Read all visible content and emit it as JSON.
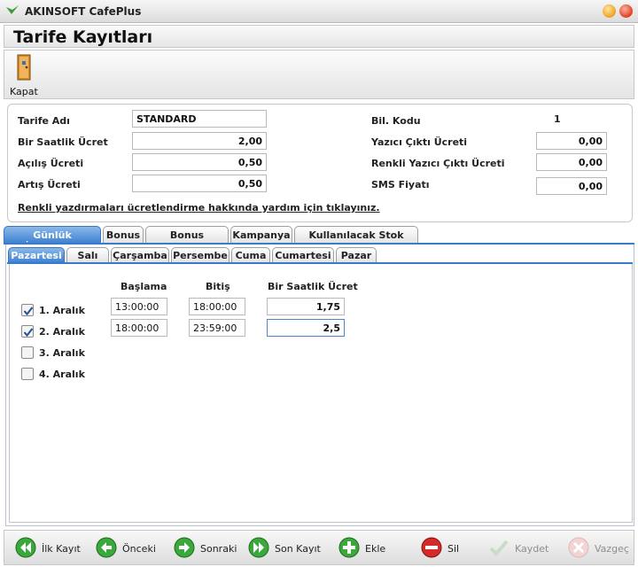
{
  "window": {
    "title": "AKINSOFT CafePlus"
  },
  "header": {
    "title": "Tarife Kayıtları"
  },
  "toolbar": {
    "close_label": "Kapat"
  },
  "form": {
    "tarife_adi": {
      "label": "Tarife Adı",
      "value": "STANDARD"
    },
    "bir_saatlik_ucret": {
      "label": "Bir Saatlik Ücret",
      "value": "2,00"
    },
    "acilis_ucreti": {
      "label": "Açılış Ücreti",
      "value": "0,50"
    },
    "artis_ucreti": {
      "label": "Artış Ücreti",
      "value": "0,50"
    },
    "bil_kodu": {
      "label": "Bil. Kodu",
      "value": "1"
    },
    "yazici_ucreti": {
      "label": "Yazıcı Çıktı Ücreti",
      "value": "0,00"
    },
    "renkli_yazici_ucreti": {
      "label": "Renkli Yazıcı Çıktı Ücreti",
      "value": "0,00"
    },
    "sms_fiyati": {
      "label": "SMS Fiyatı",
      "value": "0,00"
    },
    "help_link": "Renkli yazdırmaları ücretlendirme hakkında yardım için tıklayınız."
  },
  "tabs": [
    "Günlük İndirimler",
    "Bonus",
    "Bonus Fiyatları",
    "Kampanya",
    "Kullanılacak Stok Fiyatı"
  ],
  "active_tab": "Günlük İndirimler",
  "day_tabs": [
    "Pazartesi",
    "Salı",
    "Çarşamba",
    "Persembe",
    "Cuma",
    "Cumartesi",
    "Pazar"
  ],
  "active_day_tab": "Pazartesi",
  "intervals": {
    "headers": {
      "start": "Başlama",
      "end": "Bitiş",
      "hourly": "Bir Saatlik Ücret"
    },
    "rows": [
      {
        "label": "1. Aralık",
        "checked": true,
        "start": "13:00:00",
        "end": "18:00:00",
        "hourly": "1,75"
      },
      {
        "label": "2. Aralık",
        "checked": true,
        "start": "18:00:00",
        "end": "23:59:00",
        "hourly": "2,5"
      },
      {
        "label": "3. Aralık",
        "checked": false
      },
      {
        "label": "4. Aralık",
        "checked": false
      }
    ]
  },
  "nav": {
    "first": "İlk Kayıt",
    "prev": "Önceki",
    "next": "Sonraki",
    "last": "Son Kayıt",
    "add": "Ekle",
    "delete": "Sil",
    "save": "Kaydet",
    "cancel": "Vazgeç"
  },
  "colors": {
    "nav_green": "#3aa83a",
    "delete_red": "#d42a2a",
    "active_tab_blue": "#3c7fd0"
  }
}
